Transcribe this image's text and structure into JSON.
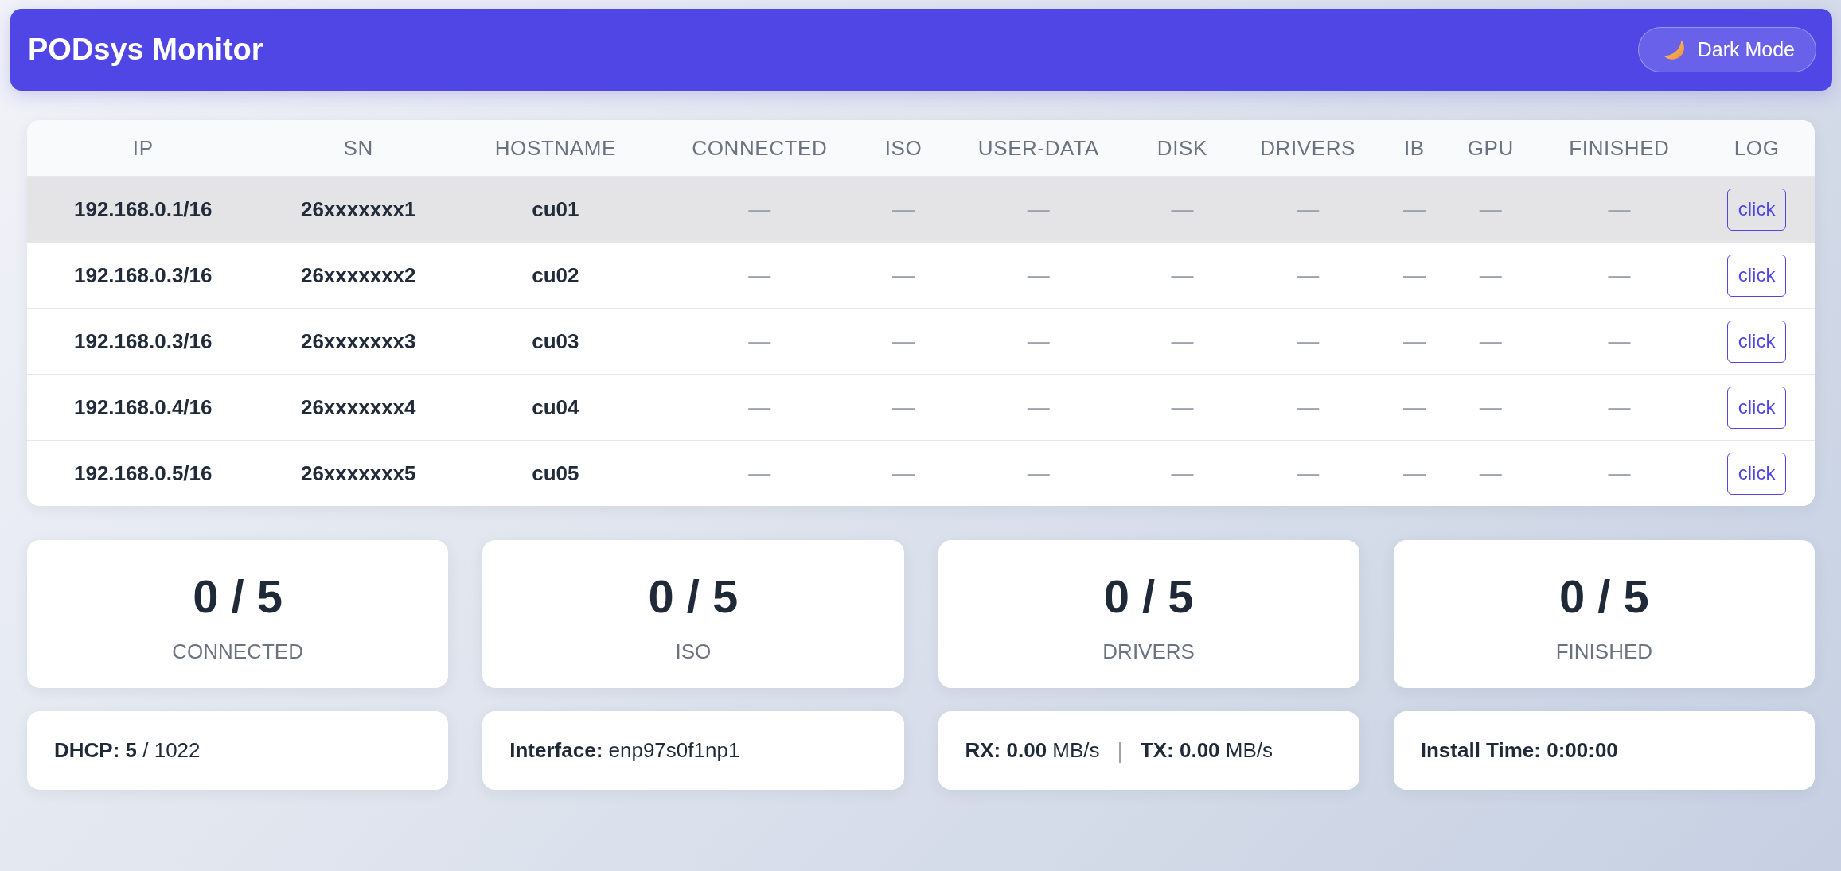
{
  "header": {
    "title": "PODsys Monitor",
    "theme_button": {
      "label": "Dark Mode"
    }
  },
  "table": {
    "columns": [
      {
        "label": "IP",
        "kind": "text"
      },
      {
        "label": "SN",
        "kind": "text"
      },
      {
        "label": "HOSTNAME",
        "kind": "text"
      },
      {
        "label": "CONNECTED",
        "kind": "status"
      },
      {
        "label": "ISO",
        "kind": "status"
      },
      {
        "label": "USER-DATA",
        "kind": "status"
      },
      {
        "label": "DISK",
        "kind": "status"
      },
      {
        "label": "DRIVERS",
        "kind": "status"
      },
      {
        "label": "IB",
        "kind": "status"
      },
      {
        "label": "GPU",
        "kind": "status"
      },
      {
        "label": "FINISHED",
        "kind": "status"
      },
      {
        "label": "LOG",
        "kind": "action"
      }
    ],
    "rows": [
      {
        "highlighted": true,
        "cells": [
          "192.168.0.1/16",
          "26xxxxxxx1",
          "cu01",
          "—",
          "—",
          "—",
          "—",
          "—",
          "—",
          "—",
          "—",
          "click"
        ]
      },
      {
        "highlighted": false,
        "cells": [
          "192.168.0.3/16",
          "26xxxxxxx2",
          "cu02",
          "—",
          "—",
          "—",
          "—",
          "—",
          "—",
          "—",
          "—",
          "click"
        ]
      },
      {
        "highlighted": false,
        "cells": [
          "192.168.0.3/16",
          "26xxxxxxx3",
          "cu03",
          "—",
          "—",
          "—",
          "—",
          "—",
          "—",
          "—",
          "—",
          "click"
        ]
      },
      {
        "highlighted": false,
        "cells": [
          "192.168.0.4/16",
          "26xxxxxxx4",
          "cu04",
          "—",
          "—",
          "—",
          "—",
          "—",
          "—",
          "—",
          "—",
          "click"
        ]
      },
      {
        "highlighted": false,
        "cells": [
          "192.168.0.5/16",
          "26xxxxxxx5",
          "cu05",
          "—",
          "—",
          "—",
          "—",
          "—",
          "—",
          "—",
          "—",
          "click"
        ]
      }
    ]
  },
  "stats": [
    {
      "value": "0 / 5",
      "label": "CONNECTED"
    },
    {
      "value": "0 / 5",
      "label": "ISO"
    },
    {
      "value": "0 / 5",
      "label": "DRIVERS"
    },
    {
      "value": "0 / 5",
      "label": "FINISHED"
    }
  ],
  "info_cards": [
    {
      "kind": "text",
      "text": "**DHCP: 5** / 1022"
    },
    {
      "kind": "text",
      "text": "**Interface:** enp97s0f1np1"
    },
    {
      "kind": "traffic",
      "rx": "**RX: 0.00** MB/s",
      "separator": "|",
      "tx": "**TX: 0.00** MB/s"
    },
    {
      "kind": "strong",
      "text": "Install Time: 0:00:00"
    }
  ]
}
